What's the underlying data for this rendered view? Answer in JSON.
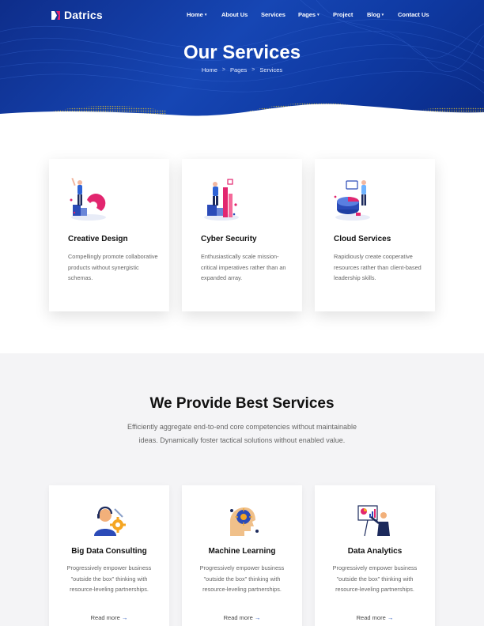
{
  "brand": {
    "name": "Datrics"
  },
  "nav": {
    "items": [
      {
        "label": "Home",
        "dropdown": true
      },
      {
        "label": "About Us",
        "dropdown": false
      },
      {
        "label": "Services",
        "dropdown": false
      },
      {
        "label": "Pages",
        "dropdown": true
      },
      {
        "label": "Project",
        "dropdown": false
      },
      {
        "label": "Blog",
        "dropdown": true
      },
      {
        "label": "Contact Us",
        "dropdown": false
      }
    ],
    "caret": "▾"
  },
  "hero": {
    "title": "Our Services",
    "breadcrumb": [
      "Home",
      "Pages",
      "Services"
    ],
    "separator": ">"
  },
  "services_top": [
    {
      "title": "Creative Design",
      "desc": "Compellingly promote collaborative products without synergistic schemas.",
      "icon": "creative-design-illustration"
    },
    {
      "title": "Cyber Security",
      "desc": "Enthusiastically scale mission-critical imperatives rather than an expanded array.",
      "icon": "cyber-security-illustration"
    },
    {
      "title": "Cloud Services",
      "desc": "Rapidiously create cooperative resources rather than client-based leadership skills.",
      "icon": "cloud-services-illustration"
    }
  ],
  "best_services": {
    "title": "We Provide Best Services",
    "desc": "Efficiently aggregate end-to-end core competencies without maintainable ideas. Dynamically foster tactical solutions without enabled value.",
    "cards": [
      {
        "title": "Big Data Consulting",
        "desc": "Progressively empower business \"outside the box\" thinking with resource-leveling partnerships.",
        "link": "Read more",
        "icon": "consultant-gear-icon"
      },
      {
        "title": "Machine Learning",
        "desc": "Progressively empower business \"outside the box\" thinking with resource-leveling partnerships.",
        "link": "Read more",
        "icon": "ai-head-icon"
      },
      {
        "title": "Data Analytics",
        "desc": "Progressively empower business \"outside the box\" thinking with resource-leveling partnerships.",
        "link": "Read more",
        "icon": "analytics-presentation-icon"
      }
    ],
    "arrow": "→"
  },
  "colors": {
    "hero_blue": "#1646b4",
    "accent_pink": "#e2266f",
    "text_dark": "#111111",
    "text_muted": "#666666"
  }
}
